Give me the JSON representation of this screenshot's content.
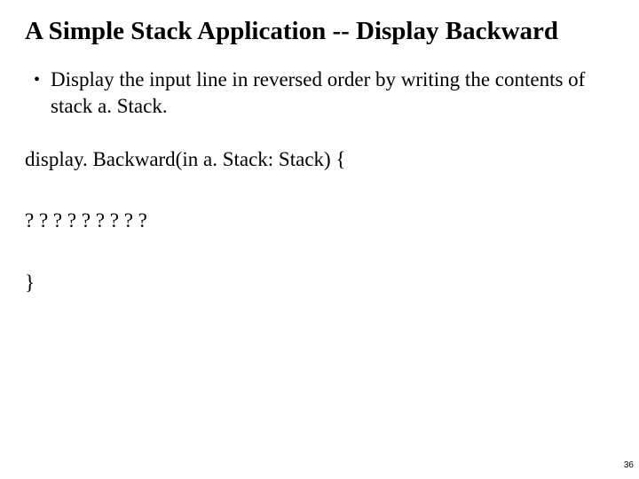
{
  "title": "A Simple Stack Application -- Display Backward",
  "bullet": {
    "text": "Display the input line in reversed order by writing the contents of stack a. Stack."
  },
  "code": {
    "line1": "display. Backward(in a. Stack: Stack) {",
    "line2": "? ? ? ? ? ? ? ? ?",
    "line3": "}"
  },
  "pageNumber": "36"
}
